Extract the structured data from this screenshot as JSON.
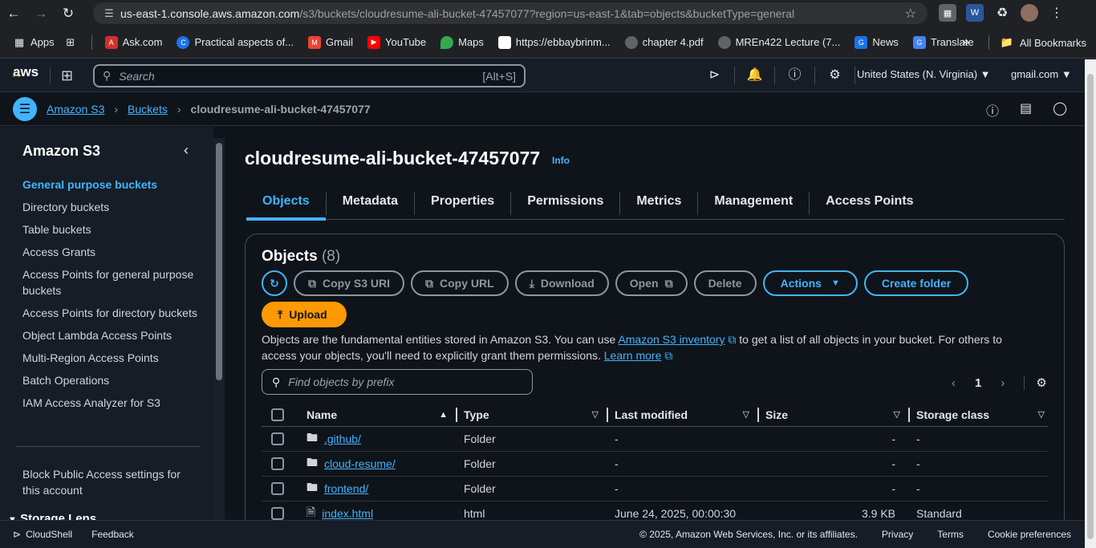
{
  "browser": {
    "url_host": "us-east-1.console.aws.amazon.com",
    "url_path": "/s3/buckets/cloudresume-ali-bucket-47457077?region=us-east-1&tab=objects&bucketType=general",
    "bookmarks": [
      "Apps",
      "Ask.com",
      "Practical aspects of...",
      "Gmail",
      "YouTube",
      "Maps",
      "https://ebbaybrinm...",
      "chapter 4.pdf",
      "MREn422 Lecture (7...",
      "News",
      "Translate"
    ],
    "all_bookmarks": "All Bookmarks"
  },
  "header": {
    "logo": "aws",
    "search_placeholder": "Search",
    "search_shortcut": "[Alt+S]",
    "region": "United States (N. Virginia)",
    "account": "gmail.com"
  },
  "breadcrumb": {
    "items": [
      "Amazon S3",
      "Buckets"
    ],
    "current": "cloudresume-ali-bucket-47457077"
  },
  "sidebar": {
    "title": "Amazon S3",
    "items": [
      {
        "label": "General purpose buckets",
        "active": true
      },
      {
        "label": "Directory buckets",
        "active": false
      },
      {
        "label": "Table buckets",
        "active": false
      },
      {
        "label": "Access Grants",
        "active": false
      },
      {
        "label": "Access Points for general purpose buckets",
        "active": false
      },
      {
        "label": "Access Points for directory buckets",
        "active": false
      },
      {
        "label": "Object Lambda Access Points",
        "active": false
      },
      {
        "label": "Multi-Region Access Points",
        "active": false
      },
      {
        "label": "Batch Operations",
        "active": false
      },
      {
        "label": "IAM Access Analyzer for S3",
        "active": false
      }
    ],
    "block_public": "Block Public Access settings for this account",
    "storage_lens": "Storage Lens"
  },
  "main": {
    "bucket_name": "cloudresume-ali-bucket-47457077",
    "info": "Info",
    "tabs": [
      "Objects",
      "Metadata",
      "Properties",
      "Permissions",
      "Metrics",
      "Management",
      "Access Points"
    ],
    "panel_title": "Objects",
    "panel_count": "(8)",
    "buttons": {
      "copy_s3_uri": "Copy S3 URI",
      "copy_url": "Copy URL",
      "download": "Download",
      "open": "Open",
      "delete": "Delete",
      "actions": "Actions",
      "create_folder": "Create folder",
      "upload": "Upload"
    },
    "description": {
      "part1": "Objects are the fundamental entities stored in Amazon S3. You can use ",
      "link1": "Amazon S3 inventory",
      "part2": " to get a list of all objects in your bucket. For others to access your objects, you'll need to explicitly grant them permissions. ",
      "link2": "Learn more"
    },
    "find_placeholder": "Find objects by prefix",
    "page": "1",
    "columns": [
      "Name",
      "Type",
      "Last modified",
      "Size",
      "Storage class"
    ],
    "rows": [
      {
        "name": ".github/",
        "type": "Folder",
        "modified": "-",
        "size": "-",
        "storage": "-"
      },
      {
        "name": "cloud-resume/",
        "type": "Folder",
        "modified": "-",
        "size": "-",
        "storage": "-"
      },
      {
        "name": "frontend/",
        "type": "Folder",
        "modified": "-",
        "size": "-",
        "storage": "-"
      },
      {
        "name": "index.html",
        "type": "html",
        "modified": "June 24, 2025, 00:00:30",
        "size": "3.9 KB",
        "storage": "Standard"
      }
    ]
  },
  "footer": {
    "cloudshell": "CloudShell",
    "feedback": "Feedback",
    "copyright": "© 2025, Amazon Web Services, Inc. or its affiliates.",
    "privacy": "Privacy",
    "terms": "Terms",
    "cookies": "Cookie preferences"
  },
  "colors": {
    "accent": "#42b4ff",
    "upload": "#ff9900",
    "bg": "#0f141a",
    "panel": "#161d26"
  }
}
